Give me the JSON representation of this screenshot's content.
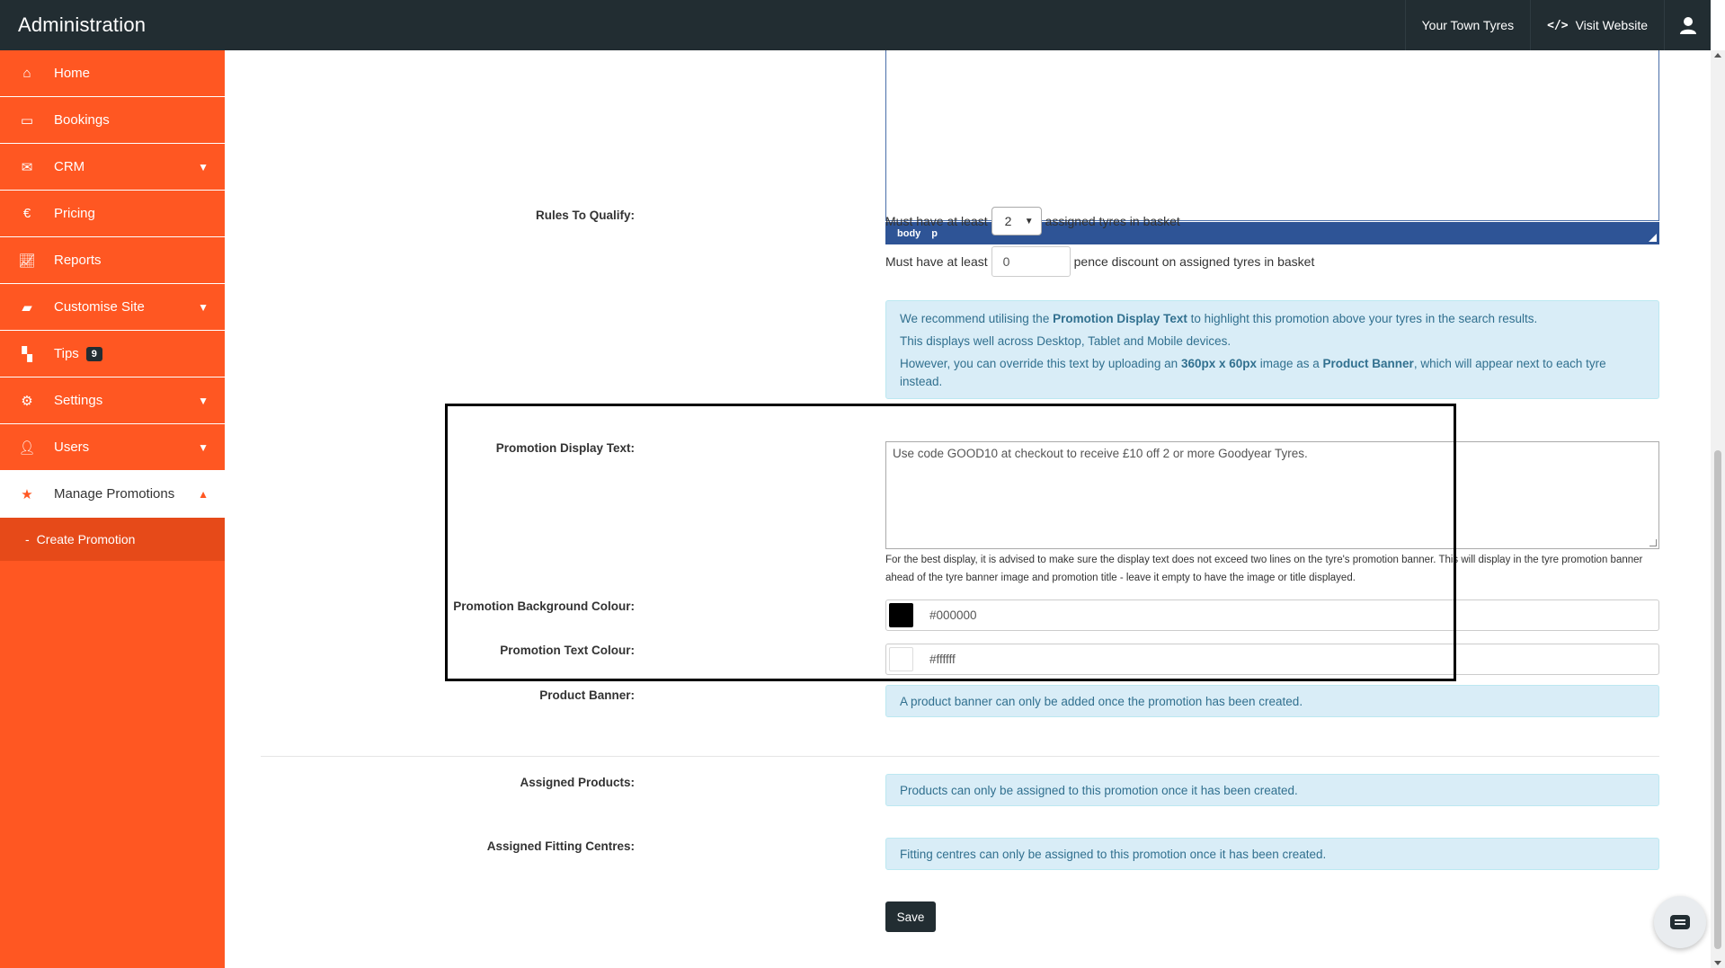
{
  "app": {
    "title": "Administration"
  },
  "topbar": {
    "site_name": "Your Town Tyres",
    "visit_label": "Visit Website",
    "visit_icon": "code-icon",
    "user_icon": "user-icon"
  },
  "sidebar": {
    "items": [
      {
        "label": "Home",
        "icon": "home-icon"
      },
      {
        "label": "Bookings",
        "icon": "credit-card-icon"
      },
      {
        "label": "CRM",
        "icon": "envelope-icon"
      },
      {
        "label": "Pricing",
        "icon": "euro-icon"
      },
      {
        "label": "Reports",
        "icon": "line-chart-icon"
      },
      {
        "label": "Customise Site",
        "icon": "paint-roller-icon"
      },
      {
        "label": "Tips",
        "icon": "binoculars-icon",
        "badge": "9"
      },
      {
        "label": "Settings",
        "icon": "gear-icon"
      },
      {
        "label": "Users",
        "icon": "user-icon"
      },
      {
        "label": "Manage Promotions",
        "icon": "star-icon"
      }
    ],
    "sub_item": {
      "dash": "-",
      "label": "Create Promotion"
    }
  },
  "editor": {
    "status_tags": [
      "body",
      "p"
    ]
  },
  "rules": {
    "label": "Rules To Qualify:",
    "line1_prefix": "Must have at least",
    "line1_value": "2",
    "line1_suffix": "assigned tyres in basket",
    "line2_prefix": "Must have at least",
    "line2_value": "0",
    "line2_suffix": "pence discount on assigned tyres in basket"
  },
  "recommend": {
    "p1_a": "We recommend utilising the ",
    "p1_b": "Promotion Display Text",
    "p1_c": " to highlight this promotion above your tyres in the search results.",
    "p2": "This displays well across Desktop, Tablet and Mobile devices.",
    "p3_a": "However, you can override this text by uploading an ",
    "p3_b": "360px x 60px",
    "p3_c": " image as a ",
    "p3_d": "Product Banner",
    "p3_e": ", which will appear next to each tyre instead."
  },
  "display_text": {
    "label": "Promotion Display Text:",
    "value": "Use code GOOD10 at checkout to receive £10 off 2 or more Goodyear Tyres.",
    "hint": "For the best display, it is advised to make sure the display text does not exceed two lines on the tyre's promotion banner. This will display in the tyre promotion banner ahead of the tyre banner image and promotion title - leave it empty to have the image or title displayed."
  },
  "bg_colour": {
    "label": "Promotion Background Colour:",
    "value": "#000000",
    "swatch": "#000000"
  },
  "text_colour": {
    "label": "Promotion Text Colour:",
    "value": "#ffffff",
    "swatch": "#ffffff"
  },
  "product_banner": {
    "label": "Product Banner:",
    "message": "A product banner can only be added once the promotion has been created."
  },
  "assigned_products": {
    "label": "Assigned Products:",
    "message": "Products can only be assigned to this promotion once it has been created."
  },
  "assigned_centres": {
    "label": "Assigned Fitting Centres:",
    "message": "Fitting centres can only be assigned to this promotion once it has been created."
  },
  "actions": {
    "save_label": "Save"
  },
  "colors": {
    "accent": "#ff5722",
    "accent_dark": "#e64a19",
    "topbar": "#222d32",
    "info_bg": "#d9edf7",
    "info_text": "#31708f"
  }
}
